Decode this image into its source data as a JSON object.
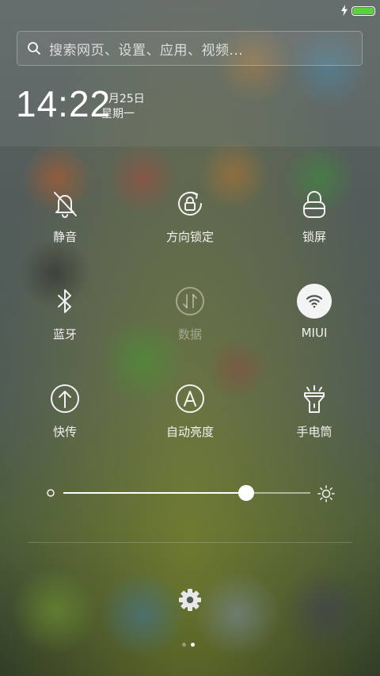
{
  "status_bar": {
    "charging_icon": "lightning-bolt-icon",
    "battery_level": 1.0,
    "battery_color": "#5ad23a"
  },
  "search": {
    "placeholder": "搜索网页、设置、应用、视频..."
  },
  "clock": {
    "time": "14:22",
    "date": "7月25日",
    "weekday": "星期一"
  },
  "toggles": [
    {
      "label": "静音",
      "icon": "bell-slash-icon",
      "state": "off"
    },
    {
      "label": "方向锁定",
      "icon": "rotation-lock-icon",
      "state": "off"
    },
    {
      "label": "锁屏",
      "icon": "lock-icon",
      "state": "off"
    },
    {
      "label": "蓝牙",
      "icon": "bluetooth-icon",
      "state": "off"
    },
    {
      "label": "数据",
      "icon": "mobile-data-icon",
      "state": "disabled"
    },
    {
      "label": "MIUI",
      "icon": "wifi-icon",
      "state": "on"
    },
    {
      "label": "快传",
      "icon": "upload-arrow-icon",
      "state": "off"
    },
    {
      "label": "自动亮度",
      "icon": "auto-brightness-icon",
      "state": "off"
    },
    {
      "label": "手电筒",
      "icon": "flashlight-icon",
      "state": "off"
    }
  ],
  "brightness": {
    "level": 0.74,
    "min_icon": "brightness-low-icon",
    "max_icon": "brightness-high-icon"
  },
  "settings_icon": "gear-icon",
  "pages": {
    "count": 2,
    "active": 1
  },
  "colors": {
    "accent_active": "#f4f4f4",
    "text": "#f2f2f2"
  }
}
